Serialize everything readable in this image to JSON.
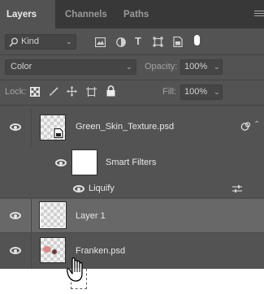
{
  "tabs": [
    {
      "label": "Layers"
    },
    {
      "label": "Channels"
    },
    {
      "label": "Paths"
    }
  ],
  "filter": {
    "kind_label": "Kind"
  },
  "blend": {
    "mode": "Color",
    "opacity_label": "Opacity:",
    "opacity_value": "100%"
  },
  "lock": {
    "label": "Lock:",
    "fill_label": "Fill:",
    "fill_value": "100%"
  },
  "layers": {
    "smart_object": {
      "name": "Green_Skin_Texture.psd"
    },
    "smart_filters": {
      "name": "Smart Filters"
    },
    "liquify": {
      "name": "Liquify"
    },
    "layer1": {
      "name": "Layer 1"
    },
    "franken": {
      "name": "Franken.psd"
    }
  },
  "colors": {
    "panel_bg": "#535353",
    "tab_bar_bg": "#383838",
    "selected_row": "#686868"
  },
  "icons": [
    "search-icon",
    "pixel-filter-icon",
    "adjustment-filter-icon",
    "type-filter-icon",
    "shape-filter-icon",
    "smart-object-filter-icon",
    "filter-toggle-icon",
    "lock-transparency-icon",
    "lock-brush-icon",
    "lock-move-icon",
    "lock-artboard-icon",
    "lock-all-icon",
    "eye-icon",
    "smart-filter-options-icon",
    "hand-cursor-icon",
    "panel-menu-icon"
  ]
}
